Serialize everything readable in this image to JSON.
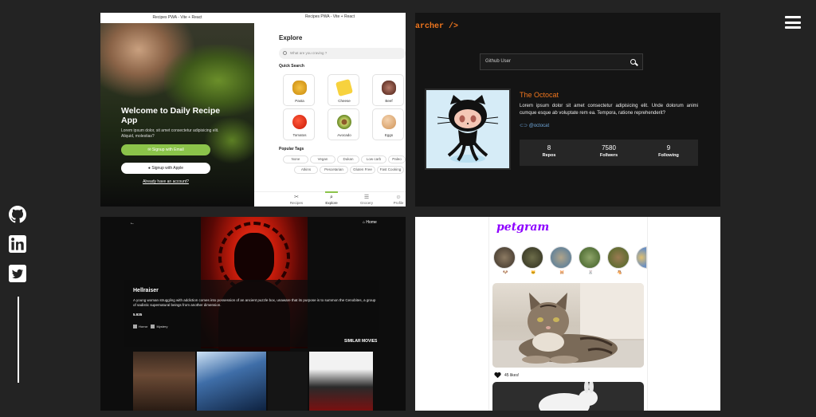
{
  "menu": {
    "icon": "hamburger-menu-icon"
  },
  "social": [
    {
      "name": "github",
      "icon": "github-icon"
    },
    {
      "name": "linkedin",
      "icon": "linkedin-icon"
    },
    {
      "name": "twitter",
      "icon": "twitter-icon"
    }
  ],
  "recipes": {
    "bar_left": "Recipes PWA - Vite + React",
    "bar_right": "Recipes PWA - Vite + React",
    "welcome": "Welcome to Daily Recipe App",
    "welcome_sub": "Lorem ipsum dolor, sit amet consectetur adipisicing elit. Aliquid, molestias?",
    "signup_email": "Signup with Email",
    "signup_apple": "Signup with Apple",
    "have_account": "Already have an account?",
    "explore": "Explore",
    "search_placeholder": "What are you craving ?",
    "quick_search": "Quick Search",
    "foods": [
      "Pasta",
      "Cheese",
      "Beef",
      "Tomatos",
      "Avocado",
      "Eggs"
    ],
    "popular_tags": "Popular Tags",
    "tags": [
      "None",
      "Vegan",
      "Dukan",
      "Low carb",
      "Paleo",
      "Atkins",
      "Pescetarian",
      "Gluten Free",
      "Fast Cooking"
    ],
    "nav": [
      "Recipes",
      "Explore",
      "Grocery",
      "Profile"
    ]
  },
  "github": {
    "title": "archer />",
    "search_label": "Github User",
    "name": "The Octocat",
    "bio": "Lorem ipsum dolor sit amet consectetur adipisicing elit. Unde dolorum animi cumque esque ab voluptate rem ea. Tempora, ratione reprehenderit?",
    "login": "@octocat",
    "stats": [
      {
        "num": "8",
        "label": "Repos"
      },
      {
        "num": "7580",
        "label": "Follwers"
      },
      {
        "num": "9",
        "label": "Following"
      }
    ]
  },
  "movie": {
    "back": "←",
    "home": "Home",
    "title": "Hellraiser",
    "description": "A young woman struggling with addiction comes into possession of an ancient puzzle box, unaware that its purpose is to summon the Cenobites, a group of sadistic supernatural beings from another dimension.",
    "rating": "5.935",
    "genres": [
      "Horror",
      "Mystery"
    ],
    "similar": "SIMILAR MOVIES"
  },
  "petgram": {
    "logo": "petgram",
    "likes": "45 likes!"
  }
}
